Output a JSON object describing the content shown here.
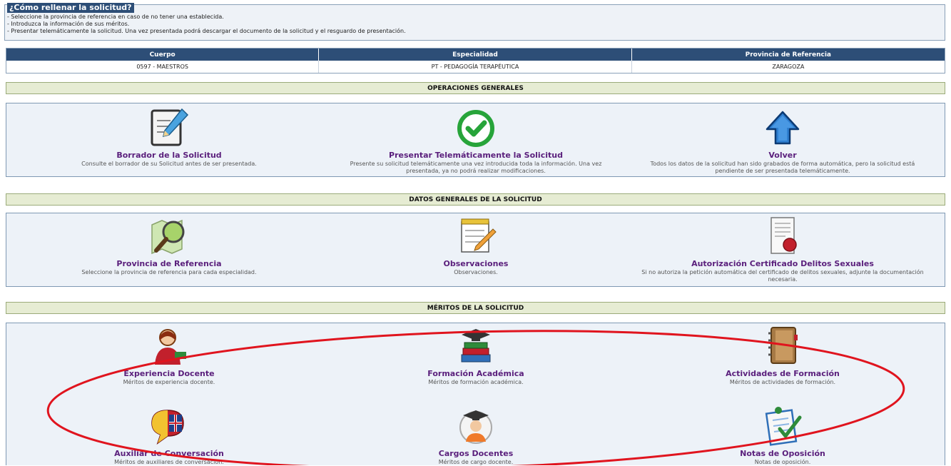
{
  "info": {
    "title": "¿Cómo rellenar la solicitud?",
    "lines": [
      "- Seleccione la provincia de referencia en caso de no tener una establecida.",
      "- Introduzca la información de sus méritos.",
      "- Presentar telemáticamente la solicitud. Una vez presentada podrá descargar el documento de la solicitud y el resguardo de presentación."
    ]
  },
  "summary": {
    "headers": [
      "Cuerpo",
      "Especialidad",
      "Provincia de Referencia"
    ],
    "values": [
      "0597 - MAESTROS",
      "PT - PEDAGOGÍA TERAPÉUTICA",
      "ZARAGOZA"
    ]
  },
  "sections": {
    "operaciones": "OPERACIONES GENERALES",
    "datos": "DATOS GENERALES DE LA SOLICITUD",
    "meritos": "MÉRITOS DE LA SOLICITUD"
  },
  "operaciones": [
    {
      "title": "Borrador de la Solicitud",
      "desc": "Consulte el borrador de su Solicitud antes de ser presentada.",
      "icon": "draft-edit-icon"
    },
    {
      "title": "Presentar Telemáticamente la Solicitud",
      "desc": "Presente su solicitud telemáticamente una vez introducida toda la información. Una vez presentada, ya no podrá realizar modificaciones.",
      "icon": "green-check-icon"
    },
    {
      "title": "Volver",
      "desc": "Todos los datos de la solicitud han sido grabados de forma automática, pero la solicitud está pendiente de ser presentada telemáticamente.",
      "icon": "up-arrow-icon"
    }
  ],
  "datos": [
    {
      "title": "Provincia de Referencia",
      "desc": "Seleccione la provincia de referencia para cada especialidad.",
      "icon": "map-magnifier-icon"
    },
    {
      "title": "Observaciones",
      "desc": "Observaciones.",
      "icon": "notepad-pencil-icon"
    },
    {
      "title": "Autorización Certificado Delitos Sexuales",
      "desc": "Si no autoriza la petición automática del certificado de delitos sexuales, adjunte la documentación necesaria.",
      "icon": "certificate-seal-icon"
    }
  ],
  "meritos": [
    {
      "title": "Experiencia Docente",
      "desc": "Méritos de experiencia docente.",
      "icon": "teacher-icon"
    },
    {
      "title": "Formación Académica",
      "desc": "Méritos de formación académica.",
      "icon": "books-graduation-icon"
    },
    {
      "title": "Actividades de Formación",
      "desc": "Méritos de actividades de formación.",
      "icon": "notebook-icon"
    },
    {
      "title": "Auxiliar de Conversación",
      "desc": "Méritos de auxiliares de conversación.",
      "icon": "flags-speech-icon"
    },
    {
      "title": "Cargos Docentes",
      "desc": "Méritos de cargo docente.",
      "icon": "graduate-avatar-icon"
    },
    {
      "title": "Notas de Oposición",
      "desc": "Notas de oposición.",
      "icon": "checklist-icon"
    }
  ],
  "colors": {
    "header_blue": "#2d4e77",
    "section_green": "#e6ecd3",
    "title_purple": "#5a1f7c",
    "annotation_red": "#e0141e"
  }
}
